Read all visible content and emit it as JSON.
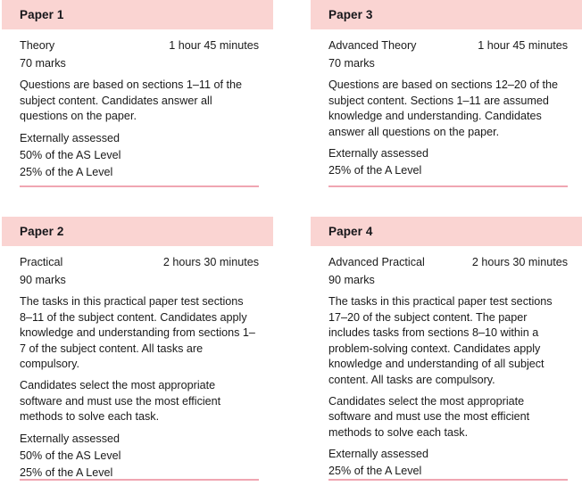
{
  "theme": {
    "header_band_color": "#fad4d2",
    "rule_color": "#f0a6b2",
    "text_color": "#1a1a1a",
    "page_background": "#ffffff"
  },
  "panels": [
    {
      "header": "Paper 1",
      "type": "Theory",
      "duration": "1 hour 45 minutes",
      "marks": "70 marks",
      "paragraphs": [
        "Questions are based on sections 1–11 of the subject content. Candidates answer all questions on the paper."
      ],
      "notes": [
        "Externally assessed",
        "50% of the AS Level",
        "25% of the A Level"
      ]
    },
    {
      "header": "Paper 3",
      "type": "Advanced Theory",
      "duration": "1 hour 45 minutes",
      "marks": "70 marks",
      "paragraphs": [
        "Questions are based on sections 12–20 of the subject content. Sections 1–11 are assumed knowledge and understanding. Candidates answer all questions on the paper."
      ],
      "notes": [
        "Externally assessed",
        "25% of the A Level"
      ]
    },
    {
      "header": "Paper 2",
      "type": "Practical",
      "duration": "2 hours 30 minutes",
      "marks": "90 marks",
      "paragraphs": [
        "The tasks in this practical paper test sections 8–11 of the subject content. Candidates apply knowledge and understanding from sections 1–7 of the subject content. All tasks are compulsory.",
        "Candidates select the most appropriate software and must use the most efficient methods to solve each task."
      ],
      "notes": [
        "Externally assessed",
        "50% of the AS Level",
        "25% of the A Level"
      ]
    },
    {
      "header": "Paper 4",
      "type": "Advanced Practical",
      "duration": "2 hours 30 minutes",
      "marks": "90 marks",
      "paragraphs": [
        "The tasks in this practical paper test sections 17–20 of the subject content. The paper includes tasks from sections 8–10 within a problem-solving context. Candidates apply knowledge and understanding of all subject content. All tasks are compulsory.",
        "Candidates select the most appropriate software and must use the most efficient methods to solve each task."
      ],
      "notes": [
        "Externally assessed",
        "25% of the A Level"
      ]
    }
  ]
}
